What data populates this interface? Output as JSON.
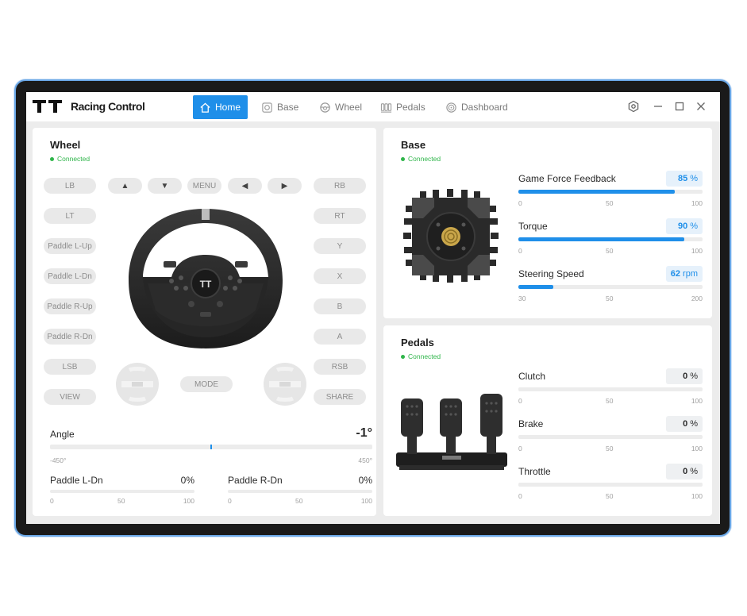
{
  "app": {
    "title": "Racing Control"
  },
  "nav": [
    {
      "label": "Home",
      "icon": "home-icon"
    },
    {
      "label": "Base",
      "icon": "base-icon"
    },
    {
      "label": "Wheel",
      "icon": "wheel-icon"
    },
    {
      "label": "Pedals",
      "icon": "pedals-icon"
    },
    {
      "label": "Dashboard",
      "icon": "dashboard-icon"
    }
  ],
  "wheel": {
    "title": "Wheel",
    "status": "Connected",
    "buttons_left": [
      "LB",
      "LT",
      "Paddle L-Up",
      "Paddle L-Dn",
      "Paddle R-Up",
      "Paddle R-Dn",
      "LSB",
      "VIEW"
    ],
    "buttons_right": [
      "RB",
      "RT",
      "Y",
      "X",
      "B",
      "A",
      "RSB",
      "SHARE"
    ],
    "top_buttons": {
      "up": "▲",
      "down": "▼",
      "menu": "MENU",
      "left": "◀",
      "right": "▶"
    },
    "mode": "MODE",
    "angle": {
      "label": "Angle",
      "value": "-1°",
      "fraction": 0.499,
      "min": "-450°",
      "max": "450°"
    },
    "paddle_l": {
      "label": "Paddle L-Dn",
      "value": "0%",
      "ticks": [
        "0",
        "50",
        "100"
      ]
    },
    "paddle_r": {
      "label": "Paddle R-Dn",
      "value": "0%",
      "ticks": [
        "0",
        "50",
        "100"
      ]
    }
  },
  "base": {
    "title": "Base",
    "status": "Connected",
    "sliders": [
      {
        "label": "Game Force Feedback",
        "value": "85",
        "unit": "%",
        "fraction": 0.85,
        "ticks": [
          "0",
          "50",
          "100"
        ]
      },
      {
        "label": "Torque",
        "value": "90",
        "unit": "%",
        "fraction": 0.9,
        "ticks": [
          "0",
          "50",
          "100"
        ]
      },
      {
        "label": "Steering Speed",
        "value": "62",
        "unit": "rpm",
        "fraction": 0.19,
        "ticks": [
          "30",
          "50",
          "200"
        ]
      }
    ]
  },
  "pedals": {
    "title": "Pedals",
    "status": "Connected",
    "sliders": [
      {
        "label": "Clutch",
        "value": "0",
        "unit": "%",
        "fraction": 0,
        "ticks": [
          "0",
          "50",
          "100"
        ]
      },
      {
        "label": "Brake",
        "value": "0",
        "unit": "%",
        "fraction": 0,
        "ticks": [
          "0",
          "50",
          "100"
        ]
      },
      {
        "label": "Throttle",
        "value": "0",
        "unit": "%",
        "fraction": 0,
        "ticks": [
          "0",
          "50",
          "100"
        ]
      }
    ]
  },
  "colors": {
    "accent": "#1f8fe9",
    "connected": "#2fb54a",
    "frame": "#6aa7e6"
  }
}
